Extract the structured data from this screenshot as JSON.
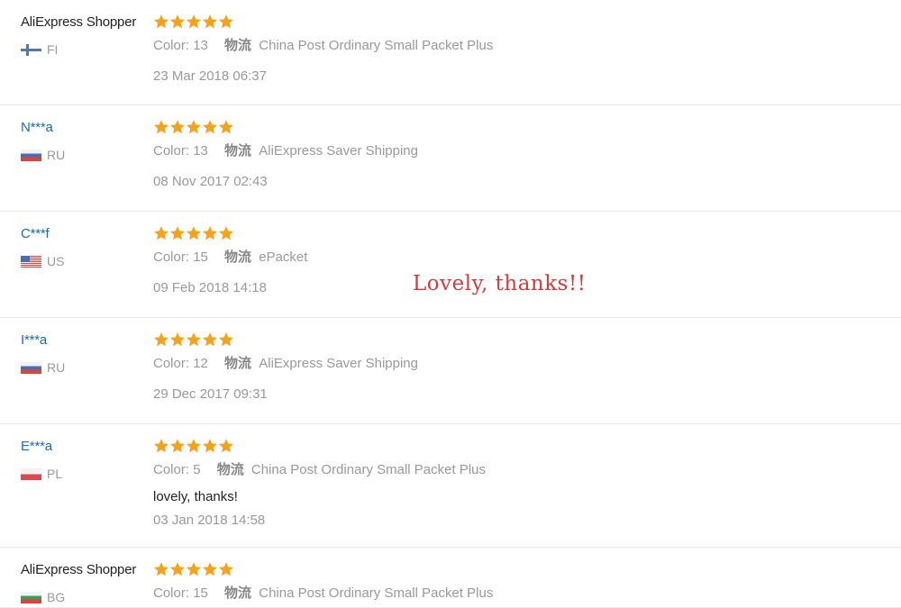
{
  "reviews": [
    {
      "user": "AliExpress Shopper",
      "user_type": "shopper",
      "country_code": "FI",
      "flag": "fi",
      "rating": 5,
      "color_label": "Color:",
      "color_value": "13",
      "shipping_label": "物流",
      "shipping_value": "China Post Ordinary Small Packet Plus",
      "comment": "",
      "date": "23 Mar 2018 06:37"
    },
    {
      "user": "N***a",
      "user_type": "masked",
      "country_code": "RU",
      "flag": "ru",
      "rating": 5,
      "color_label": "Color:",
      "color_value": "13",
      "shipping_label": "物流",
      "shipping_value": "AliExpress Saver Shipping",
      "comment": "",
      "date": "08 Nov 2017 02:43"
    },
    {
      "user": "C***f",
      "user_type": "masked",
      "country_code": "US",
      "flag": "us",
      "rating": 5,
      "color_label": "Color:",
      "color_value": "15",
      "shipping_label": "物流",
      "shipping_value": "ePacket",
      "comment": "",
      "date": "09 Feb 2018 14:18"
    },
    {
      "user": "I***a",
      "user_type": "masked",
      "country_code": "RU",
      "flag": "ru",
      "rating": 5,
      "color_label": "Color:",
      "color_value": "12",
      "shipping_label": "物流",
      "shipping_value": "AliExpress Saver Shipping",
      "comment": "",
      "date": "29 Dec 2017 09:31"
    },
    {
      "user": "E***a",
      "user_type": "masked",
      "country_code": "PL",
      "flag": "pl",
      "rating": 5,
      "color_label": "Color:",
      "color_value": "5",
      "shipping_label": "物流",
      "shipping_value": "China Post Ordinary Small Packet Plus",
      "comment": "lovely, thanks!",
      "date": "03 Jan 2018 14:58"
    },
    {
      "user": "AliExpress Shopper",
      "user_type": "shopper",
      "country_code": "BG",
      "flag": "bg",
      "rating": 5,
      "color_label": "Color:",
      "color_value": "15",
      "shipping_label": "物流",
      "shipping_value": "China Post Ordinary Small Packet Plus",
      "comment": "",
      "date": ""
    }
  ],
  "overlay": {
    "text": "Lovely, thanks!!"
  },
  "colors": {
    "star": "#f7a21b",
    "user_link": "#1a6ab7",
    "meta_gray": "#999999",
    "overlay_red": "#d23b3b"
  },
  "icons": {
    "star": "star-icon"
  }
}
